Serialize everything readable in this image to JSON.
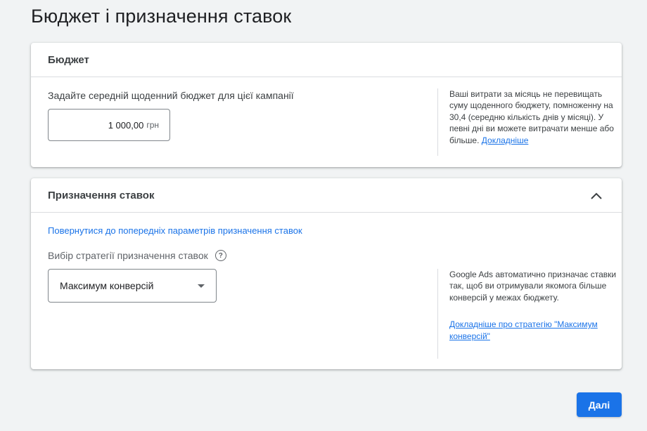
{
  "page": {
    "title": "Бюджет і призначення ставок"
  },
  "budget": {
    "header": "Бюджет",
    "prompt": "Задайте середній щоденний бюджет для цієї кампанії",
    "amount": "1 000,00",
    "currency": "грн",
    "note": "Ваші витрати за місяць не перевищать суму щоденного бюджету, помноженну на 30,4 (середню кількість днів у місяці). У певні дні ви можете витрачати менше або більше.",
    "note_link": "Докладніше"
  },
  "bidding": {
    "header": "Призначення ставок",
    "back_link": "Повернутися до попередніх параметрів призначення ставок",
    "strategy_label": "Вибір стратегії призначення ставок",
    "help_glyph": "?",
    "selected_strategy": "Максимум конверсій",
    "note": "Google Ads автоматично призначає ставки так, щоб ви отримували якомога більше конверсій у межах бюджету.",
    "note_link": "Докладніше про стратегію \"Максимум конверсій\""
  },
  "actions": {
    "next_label": "Далі"
  },
  "colors": {
    "accent": "#1a73e8",
    "background": "#f1f3f4"
  },
  "icons": {
    "collapse": "chevron-up-icon",
    "help": "help-circle-icon",
    "dropdown": "caret-down-icon"
  }
}
